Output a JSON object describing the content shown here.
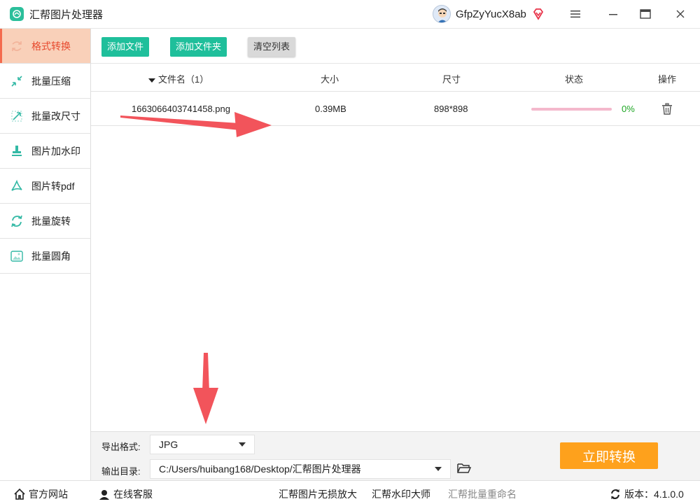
{
  "app": {
    "title": "汇帮图片处理器"
  },
  "user": {
    "name": "GfpZyYucX8ab"
  },
  "colors": {
    "accent": "#1fbf9b",
    "active_bg": "#f9d0b9",
    "active_text": "#e74a2e",
    "convert": "#fea11c",
    "progress": "#e84d84",
    "percent": "#1ea624"
  },
  "sidebar": {
    "items": [
      {
        "label": "格式转换",
        "icon": "swap-icon",
        "active": true
      },
      {
        "label": "批量压缩",
        "icon": "compress-icon",
        "active": false
      },
      {
        "label": "批量改尺寸",
        "icon": "resize-icon",
        "active": false
      },
      {
        "label": "图片加水印",
        "icon": "watermark-icon",
        "active": false
      },
      {
        "label": "图片转pdf",
        "icon": "pdf-icon",
        "active": false
      },
      {
        "label": "批量旋转",
        "icon": "rotate-icon",
        "active": false
      },
      {
        "label": "批量圆角",
        "icon": "image-corner-icon",
        "active": false
      }
    ]
  },
  "toolbar": {
    "add_file": "添加文件",
    "add_folder": "添加文件夹",
    "clear_list": "清空列表"
  },
  "table": {
    "headers": {
      "name": "文件名（1）",
      "size": "大小",
      "dimensions": "尺寸",
      "status": "状态",
      "actions": "操作"
    },
    "rows": [
      {
        "name": "1663066403741458.png",
        "size": "0.39MB",
        "dimensions": "898*898",
        "progress": 0,
        "percent": "0%"
      }
    ]
  },
  "bottom": {
    "format_label": "导出格式:",
    "format_value": "JPG",
    "output_label": "输出目录:",
    "output_value": "C:/Users/huibang168/Desktop/汇帮图片处理器",
    "convert_label": "立即转换"
  },
  "footer": {
    "website": "官方网站",
    "support": "在线客服",
    "link1": "汇帮图片无损放大",
    "link2": "汇帮水印大师",
    "link3": "汇帮批量重命名",
    "version_label": "版本：",
    "version_value": "4.1.0.0"
  }
}
